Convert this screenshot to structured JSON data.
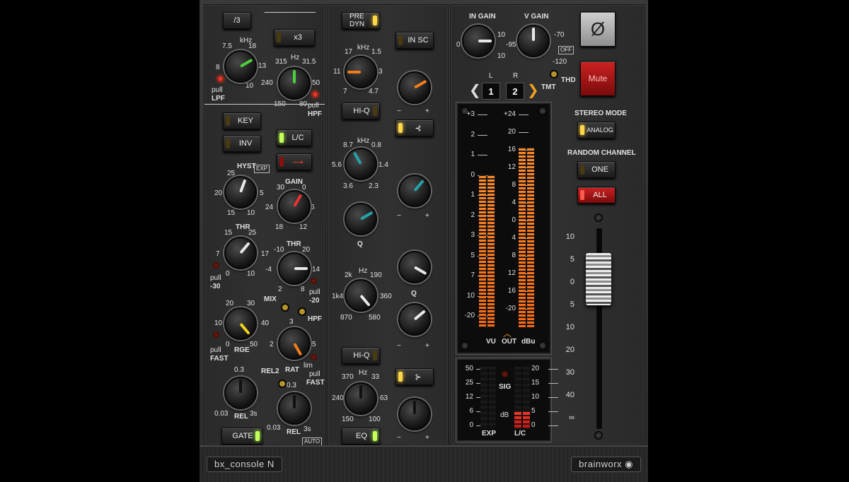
{
  "plugin": {
    "name": "bx_console N",
    "brand": "brainworx"
  },
  "col1": {
    "div3": "/3",
    "x3": "x3",
    "lpf": {
      "unit": "kHz",
      "t1": "7.5",
      "t2": "18",
      "t3": "13",
      "t4": "8",
      "t5": "10",
      "pull": "pull",
      "tag": "LPF"
    },
    "hpf": {
      "unit": "Hz",
      "t1": "315",
      "t2": "31.5",
      "t3": "240",
      "t4": "50",
      "t5": "150",
      "t6": "80",
      "pull": "pull",
      "tag": "HPF"
    },
    "key": "KEY",
    "inv": "INV",
    "lc": "L/C",
    "hyst": {
      "name": "HYST",
      "exp": "EXP",
      "t1": "25",
      "t2": "20",
      "t3": "5",
      "t4": "15",
      "t5": "10"
    },
    "gain": {
      "name": "GAIN",
      "t1": "30",
      "t2": "0",
      "t3": "24",
      "t4": "6",
      "t5": "18",
      "t6": "12"
    },
    "thr1": {
      "name": "THR",
      "t1": "15",
      "t2": "25",
      "t3": "7",
      "t4": "17",
      "t5": "0",
      "t6": "10",
      "pull": "pull",
      "tag": "-30"
    },
    "thr2": {
      "name": "THR",
      "t1": "-10",
      "t2": "20",
      "t3": "-4",
      "t4": "14",
      "t5": "2",
      "t6": "8",
      "pull": "pull",
      "tag": "-20"
    },
    "mix": "MIX",
    "hpf2": "HPF",
    "rge": {
      "name": "RGE",
      "t1": "20",
      "t2": "30",
      "t3": "10",
      "t4": "40",
      "t5": "0",
      "t6": "50",
      "pull": "pull",
      "tag": "FAST"
    },
    "rat": {
      "name": "RAT",
      "t1": "3",
      "t2": "2",
      "t3": "5",
      "t4": "lim",
      "pull": "pull",
      "tag": "FAST"
    },
    "rel2": "REL2",
    "rel1": {
      "name": "REL",
      "t1": "0.3",
      "t2": "0.03",
      "t3": "3s"
    },
    "rel3": {
      "name": "REL",
      "t1": "0.3",
      "t2": "0.03",
      "t3": "3s"
    },
    "gate": "GATE",
    "auto": "AUTO"
  },
  "col2": {
    "predyn": "PRE DYN",
    "insc": "IN SC",
    "hf": {
      "unit": "kHz",
      "t1": "17",
      "t2": "1.5",
      "t3": "11",
      "t4": "3",
      "t5": "7",
      "t6": "4.7"
    },
    "hiq1": "HI-Q",
    "hmf": {
      "unit": "kHz",
      "t1": "8.7",
      "t2": "0.8",
      "t3": "5.6",
      "t4": "1.4",
      "t5": "3.6",
      "t6": "2.3"
    },
    "q1": "Q",
    "lmf": {
      "unit": "Hz",
      "t1": "2k",
      "t2": "190",
      "t3": "1k4",
      "t4": "360",
      "t5": "870",
      "t6": "580"
    },
    "q2": "Q",
    "hiq2": "HI-Q",
    "lf": {
      "unit": "Hz",
      "t1": "370",
      "t2": "33",
      "t3": "240",
      "t4": "63",
      "t5": "150",
      "t6": "100"
    },
    "eq": "EQ",
    "minus": "−",
    "plus": "+"
  },
  "col3": {
    "in_gain": {
      "label": "IN GAIN",
      "t1": "0",
      "t2": "10",
      "t3": "10"
    },
    "v_gain": {
      "label": "V GAIN",
      "t1": "-95",
      "t2": "-70",
      "t3": "-120",
      "off": "OFF"
    },
    "thd": "THD",
    "tmt": "TMT",
    "ch_l": "L",
    "ch_r": "R",
    "ch1": "1",
    "ch2": "2",
    "vu_scale": [
      "+3",
      "2",
      "1",
      "0",
      "1",
      "2",
      "3",
      "5",
      "7",
      "10",
      "-20"
    ],
    "dbu_scale": [
      "+24",
      "20",
      "16",
      "12",
      "8",
      "4",
      "0",
      "4",
      "8",
      "12",
      "16",
      "-20"
    ],
    "vu": "VU",
    "out": "OUT",
    "dbu": "dBu",
    "exp_scale": [
      "50",
      "25",
      "12",
      "6",
      "0"
    ],
    "lc_scale": [
      "20",
      "15",
      "10",
      "5",
      "0"
    ],
    "sig": "SIG",
    "db": "dB",
    "exp": "EXP",
    "lc": "L/C"
  },
  "col4": {
    "phase": "Ø",
    "mute": "Mute",
    "stereo_mode": "STEREO MODE",
    "analog": "ANALOG",
    "random_channel": "RANDOM CHANNEL",
    "one": "ONE",
    "all": "ALL",
    "fader_scale": [
      "10",
      "5",
      "0",
      "5",
      "10",
      "20",
      "30",
      "40",
      "∞"
    ]
  },
  "meters": {
    "vu_level": 0.72,
    "dbu_level": 0.85,
    "lc_level": 0.3
  }
}
